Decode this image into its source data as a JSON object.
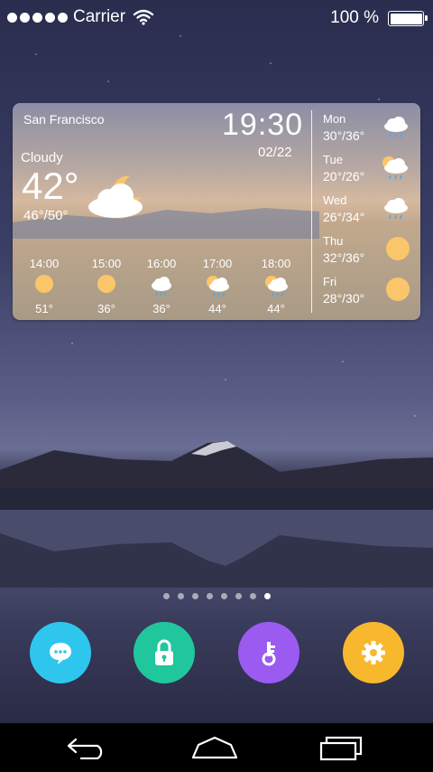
{
  "status_bar": {
    "carrier": "Carrier",
    "battery_pct": "100 %",
    "signal_icon": "signal-dots-icon",
    "wifi_icon": "wifi-icon",
    "battery_icon": "battery-icon"
  },
  "weather_widget": {
    "city": "San Francisco",
    "time": "19:30",
    "date": "02/22",
    "condition": "Cloudy",
    "temperature": "42°",
    "range": "46°/50°",
    "icon": "cloud-moon-icon",
    "hourly": [
      {
        "time": "14:00",
        "temp": "51°",
        "icon": "sun-icon"
      },
      {
        "time": "15:00",
        "temp": "36°",
        "icon": "sun-icon"
      },
      {
        "time": "16:00",
        "temp": "36°",
        "icon": "cloud-rain-icon"
      },
      {
        "time": "17:00",
        "temp": "44°",
        "icon": "sun-cloud-rain-icon"
      },
      {
        "time": "18:00",
        "temp": "44°",
        "icon": "sun-cloud-rain-icon"
      }
    ],
    "daily": [
      {
        "day": "Mon",
        "range": "30°/36°",
        "icon": "cloud-rain-icon"
      },
      {
        "day": "Tue",
        "range": "20°/26°",
        "icon": "sun-cloud-rain-icon"
      },
      {
        "day": "Wed",
        "range": "26°/34°",
        "icon": "cloud-rain-icon"
      },
      {
        "day": "Thu",
        "range": "32°/36°",
        "icon": "sun-icon"
      },
      {
        "day": "Fri",
        "range": "28°/30°",
        "icon": "sun-icon"
      }
    ]
  },
  "page_indicator": {
    "count": 8,
    "active_index": 7
  },
  "dock": {
    "apps": [
      {
        "name": "messages",
        "icon": "chat-bubble-icon",
        "color": "#2fc6ee"
      },
      {
        "name": "lock",
        "icon": "padlock-icon",
        "color": "#21c79c"
      },
      {
        "name": "key",
        "icon": "key-icon",
        "color": "#9b5bf0"
      },
      {
        "name": "settings",
        "icon": "gear-icon",
        "color": "#f8b82d"
      }
    ]
  },
  "nav_bar": {
    "back_icon": "back-arrow-icon",
    "home_icon": "home-icon",
    "recents_icon": "recents-icon"
  }
}
